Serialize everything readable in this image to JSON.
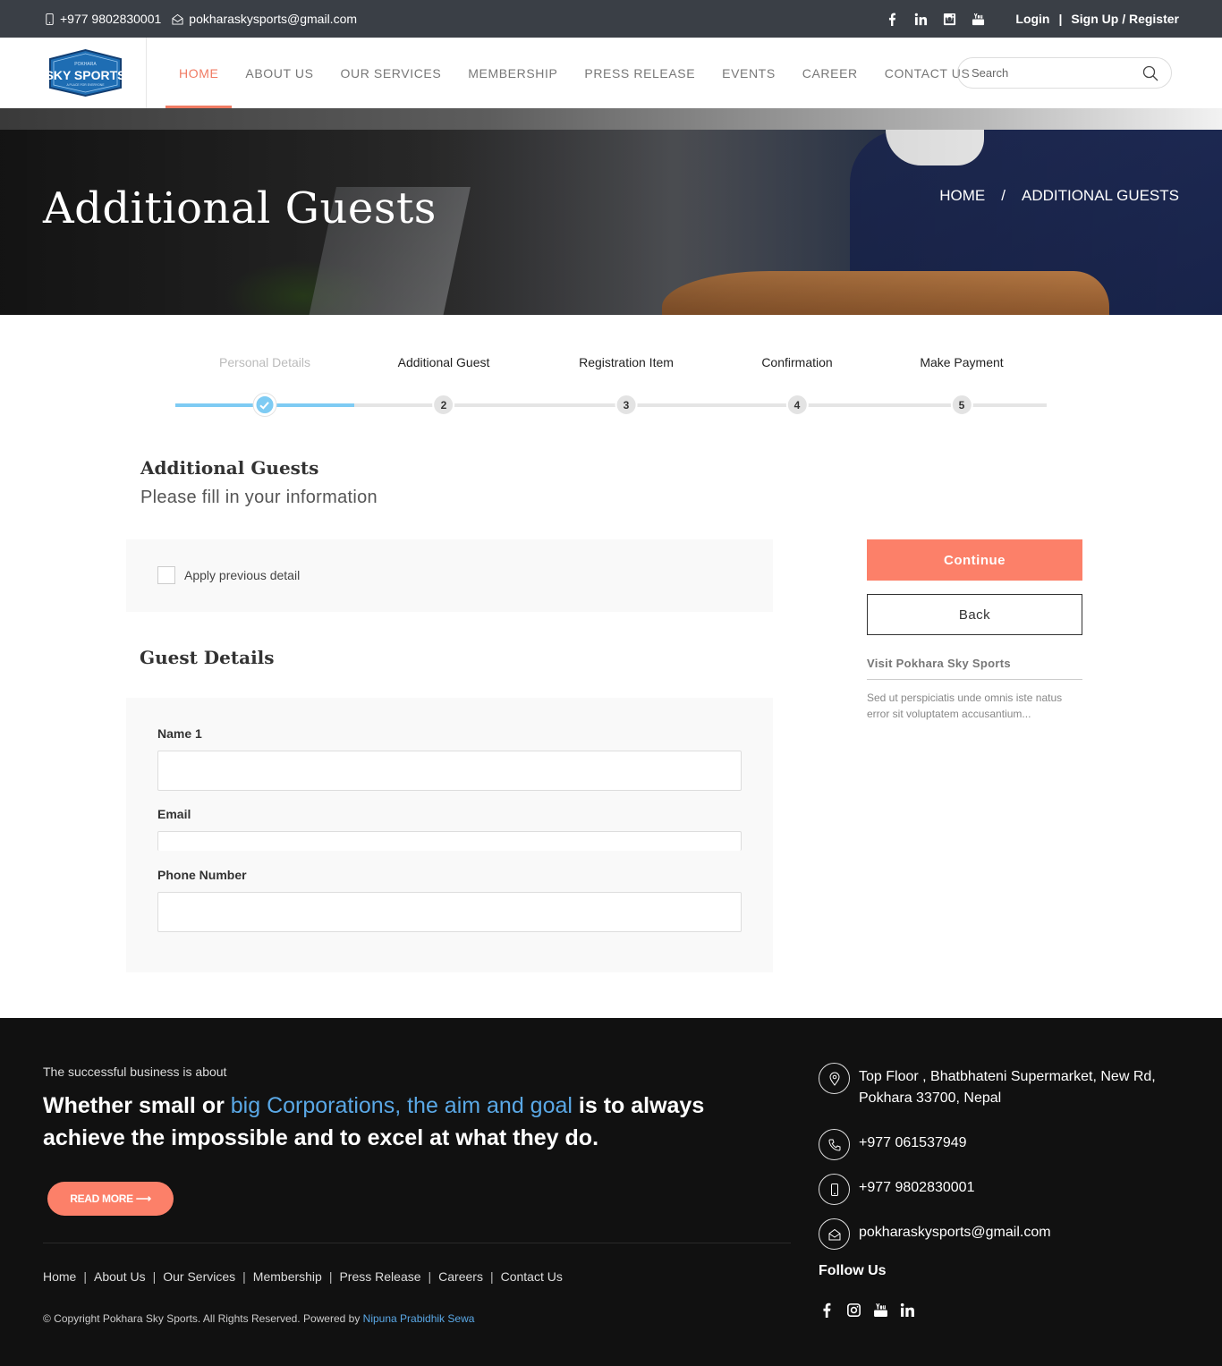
{
  "topbar": {
    "phone": "+977 9802830001",
    "email": "pokharaskysports@gmail.com",
    "login": "Login",
    "separator": "|",
    "signup": "Sign Up / Register"
  },
  "header": {
    "logo_top": "POKHARA",
    "logo_text": "SKY SPORTS",
    "logo_tagline": "A PLACE FOR EVERYONE",
    "nav": [
      "HOME",
      "ABOUT US",
      "OUR SERVICES",
      "MEMBERSHIP",
      "PRESS RELEASE",
      "EVENTS",
      "CAREER",
      "CONTACT US"
    ],
    "search_placeholder": "Search"
  },
  "banner": {
    "title": "Additional Guests",
    "crumb_home": "HOME",
    "crumb_sep": "/",
    "crumb_current": "ADDITIONAL GUESTS"
  },
  "steps": [
    {
      "label": "Personal Details",
      "num": "1",
      "done": true
    },
    {
      "label": "Additional Guest",
      "num": "2",
      "done": false
    },
    {
      "label": "Registration Item",
      "num": "3",
      "done": false
    },
    {
      "label": "Confirmation",
      "num": "4",
      "done": false
    },
    {
      "label": "Make Payment",
      "num": "5",
      "done": false
    }
  ],
  "form": {
    "title": "Additional Guests",
    "subtitle": "Please fill in your information",
    "apply_previous": "Apply previous detail",
    "guest_title": "Guest Details",
    "name_label": "Name 1",
    "name_value": "",
    "email_label": "Email",
    "email_value": "",
    "phone_label": "Phone Number",
    "phone_value": ""
  },
  "sidebar": {
    "continue": "Continue",
    "back": "Back",
    "visit_title": "Visit Pokhara Sky Sports",
    "visit_desc": "Sed ut perspiciatis unde omnis iste natus error sit voluptatem accusantium..."
  },
  "footer": {
    "kicker": "The successful business is about",
    "head_1": "Whether small or ",
    "head_hl": "big Corporations, the aim and goal",
    "head_2": " is to always achieve the impossible and to excel at what they do.",
    "read_more": "READ MORE ⟶",
    "links": [
      "Home",
      "About Us",
      "Our Services",
      "Membership",
      "Press Release",
      "Careers",
      "Contact Us"
    ],
    "copyright": "© Copyright Pokhara Sky Sports. All Rights Reserved. Powered by ",
    "powered_by": "Nipuna Prabidhik Sewa",
    "address": "Top Floor , Bhatbhateni Supermarket, New Rd, Pokhara 33700, Nepal",
    "phone1": "+977 061537949",
    "phone2": "+977 9802830001",
    "email": "pokharaskysports@gmail.com",
    "follow": "Follow Us"
  },
  "colors": {
    "accent": "#fc8069",
    "nav_active": "#f07b63",
    "step_done": "#7ecbf3",
    "link_blue": "#5aa8e6",
    "topbar_bg": "#3a3f46",
    "footer_bg": "#111111"
  },
  "icons": {
    "topbar_social": [
      "facebook-icon",
      "linkedin-icon",
      "instagram-icon",
      "youtube-icon"
    ],
    "footer_social": [
      "facebook-icon",
      "instagram-icon",
      "youtube-icon",
      "linkedin-icon"
    ]
  }
}
